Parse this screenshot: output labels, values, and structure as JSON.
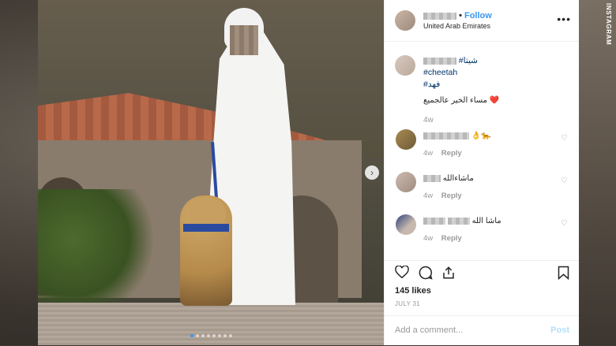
{
  "header": {
    "follow_label": "Follow",
    "separator": "•",
    "location": "United Arab Emirates",
    "more_label": "•••"
  },
  "caption": {
    "hashtags": [
      "#شيتا",
      "#cheetah",
      "#فهد"
    ],
    "text": "مساء الخير عالجميع",
    "heart": "❤️",
    "time": "4w"
  },
  "comments": [
    {
      "text": "👌🐆",
      "time": "4w",
      "reply_label": "Reply",
      "heart": "♡"
    },
    {
      "text": "ماشاءالله",
      "time": "4w",
      "reply_label": "Reply",
      "heart": "♡"
    },
    {
      "text": "ماشا الله",
      "time": "4w",
      "reply_label": "Reply",
      "heart": "♡"
    }
  ],
  "actions": {
    "likes": "145 likes",
    "date": "JULY 31"
  },
  "add_comment": {
    "placeholder": "Add a comment...",
    "post_label": "Post"
  },
  "watermark": "INSTAGRAM",
  "carousel": {
    "next_label": "›",
    "dot_count": 8,
    "active_index": 0
  },
  "colors": {
    "link": "#3897f0",
    "hashtag": "#003569",
    "post_disabled": "#b2dffc"
  }
}
